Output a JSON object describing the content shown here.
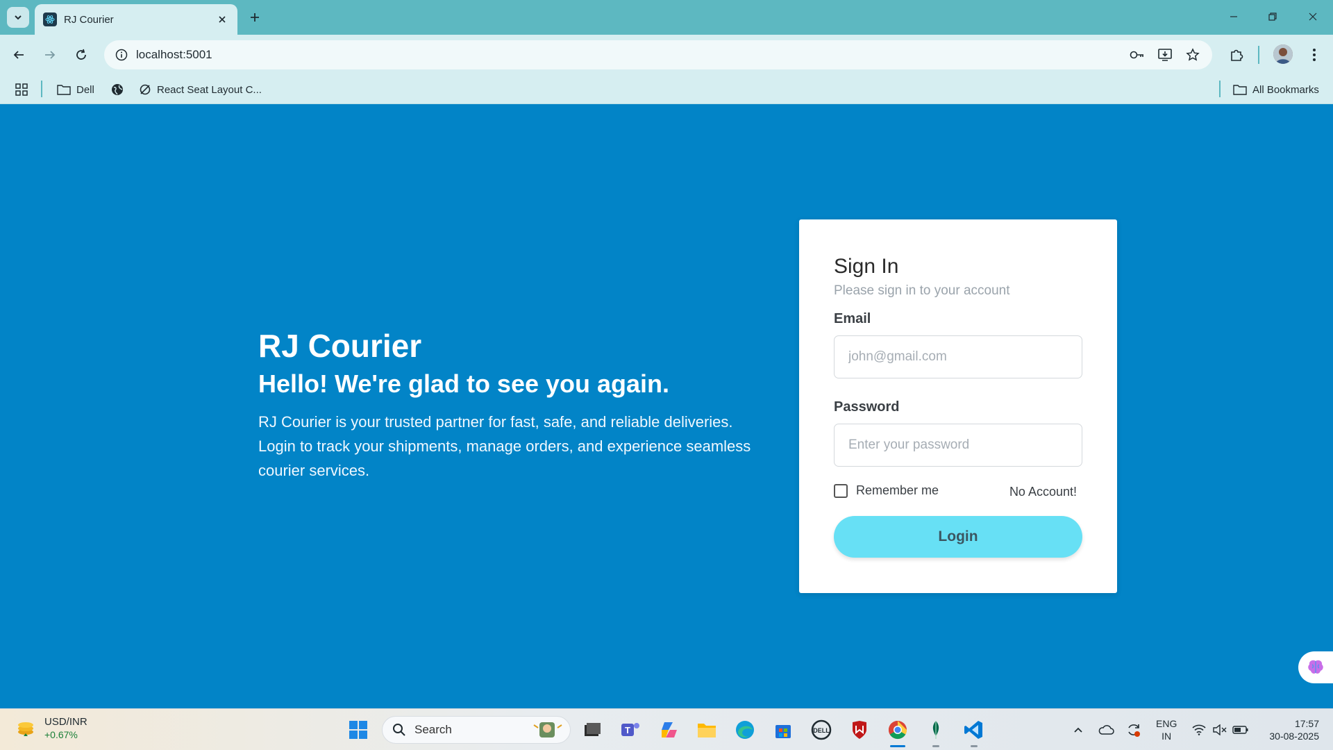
{
  "browser": {
    "tab_title": "RJ Courier",
    "url": "localhost:5001",
    "bookmarks": [
      {
        "label": "Dell"
      },
      {
        "label": ""
      },
      {
        "label": "React Seat Layout C..."
      }
    ],
    "all_bookmarks_label": "All Bookmarks"
  },
  "hero": {
    "brand": "RJ Courier",
    "headline": "Hello! We're glad to see you again.",
    "description": "RJ Courier is your trusted partner for fast, safe, and reliable deliveries. Login to track your shipments, manage orders, and experience seamless courier services."
  },
  "signin": {
    "title": "Sign In",
    "subtitle": "Please sign in to your account",
    "email_label": "Email",
    "email_placeholder": "john@gmail.com",
    "password_label": "Password",
    "password_placeholder": "Enter your password",
    "remember_label": "Remember me",
    "no_account_label": "No Account!",
    "login_label": "Login"
  },
  "taskbar": {
    "ticker_name": "USD/INR",
    "ticker_change": "+0.67%",
    "search_label": "Search",
    "lang_line1": "ENG",
    "lang_line2": "IN",
    "time": "17:57",
    "date": "30-08-2025"
  },
  "colors": {
    "page_bg": "#0284c7",
    "login_button": "#67e0f5",
    "chrome_accent": "#5db8c1"
  }
}
